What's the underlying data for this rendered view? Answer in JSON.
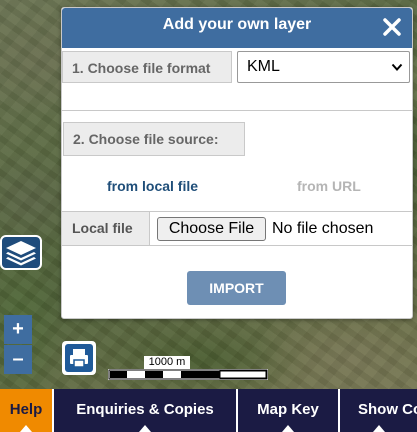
{
  "dialog": {
    "title": "Add your own layer",
    "close_label": "✕",
    "step1_label": "1. Choose file format",
    "format_selected": "KML",
    "step2_label": "2. Choose file source:",
    "tab_local": "from local file",
    "tab_url": "from URL",
    "local_file_label": "Local file",
    "choose_file_label": "Choose File",
    "no_file_text": "No file chosen",
    "import_label": "IMPORT"
  },
  "map_controls": {
    "zoom_in": "+",
    "zoom_out": "–",
    "scale_text": "1000 m"
  },
  "bottom_nav": {
    "help": "Help",
    "enquiries": "Enquiries & Copies",
    "map_key": "Map Key",
    "show": "Show Co"
  },
  "colors": {
    "header_blue": "#3f6da0",
    "active_tab": "#1f4e79",
    "inactive_tab": "#b5b5b5",
    "help_orange": "#f08a00",
    "nav_bg": "#1b1b44"
  },
  "icons": {
    "close": "close-icon",
    "layers": "layers-icon",
    "print": "print-icon",
    "dropdown": "chevron-down-icon"
  }
}
